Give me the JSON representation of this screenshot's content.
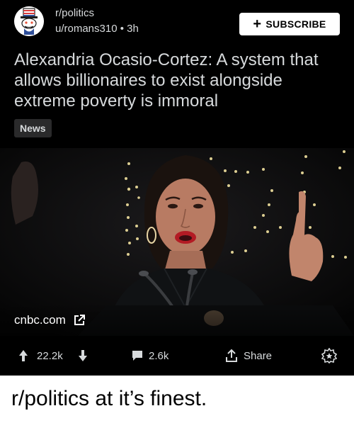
{
  "post": {
    "subreddit": "r/politics",
    "author": "u/romans310",
    "separator": "•",
    "age": "3h",
    "subscribe_label": "SUBSCRIBE",
    "title": "Alexandria Ocasio-Cortez: A system that allows billionaires to exist alongside extreme poverty is immoral",
    "flair": "News",
    "link_domain": "cnbc.com",
    "upvotes": "22.2k",
    "comments": "2.6k",
    "share_label": "Share"
  },
  "icons": {
    "subreddit_avatar": "snoo-uncle-sam-icon",
    "subscribe": "plus-icon",
    "external_link": "external-link-icon",
    "upvote": "upvote-arrow-icon",
    "downvote": "downvote-arrow-icon",
    "comments": "comment-bubble-icon",
    "share": "share-icon",
    "award": "award-icon"
  },
  "colors": {
    "card_background": "#000000",
    "card_text": "#d7dadc",
    "button_background": "#ffffff",
    "flair_background": "#2a2a2b"
  },
  "caption": "r/politics at it’s finest."
}
